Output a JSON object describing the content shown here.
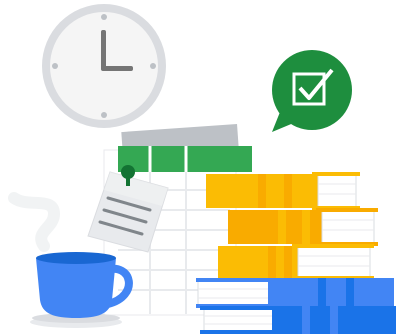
{
  "illustration": {
    "elements": [
      "clock-icon",
      "checkbox-speech-bubble-icon",
      "spreadsheet-paper",
      "pinned-note",
      "coffee-cup-icon",
      "book-stack"
    ]
  },
  "colors": {
    "clock_rim": "#e0e0e0",
    "clock_face": "#f5f5f5",
    "clock_hands": "#757575",
    "bubble_green": "#1e8e3e",
    "sheet_header_green": "#34a853",
    "note_gray": "#e8eaed",
    "pin_green": "#137333",
    "cup_blue": "#4285f4",
    "cup_dark_blue": "#1967d2",
    "book_yellow": "#fbbc04",
    "book_orange": "#f9ab00",
    "book_blue": "#4285f4",
    "book_dark_blue": "#1a73e8",
    "pages_white": "#ffffff"
  }
}
